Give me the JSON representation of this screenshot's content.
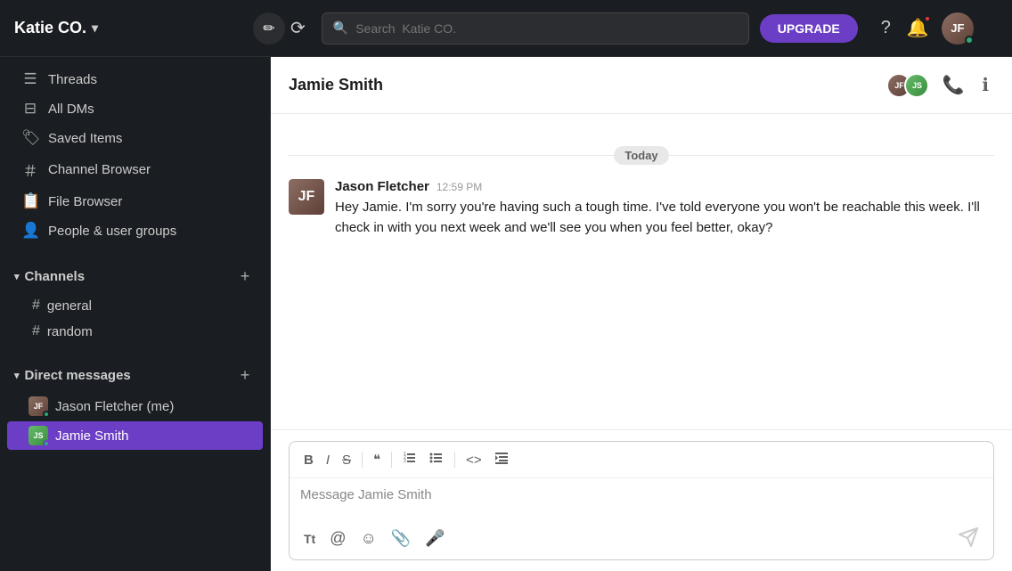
{
  "topbar": {
    "workspace_name": "Katie CO.",
    "chevron": "▾",
    "search_placeholder": "Search  Katie CO.",
    "upgrade_label": "UPGRADE",
    "history_icon": "↺",
    "help_icon": "?",
    "notification_icon": "🔔"
  },
  "sidebar": {
    "nav_items": [
      {
        "id": "threads",
        "label": "Threads",
        "icon": "≡"
      },
      {
        "id": "all-dms",
        "label": "All DMs",
        "icon": "⊡"
      },
      {
        "id": "saved",
        "label": "Saved Items",
        "icon": "🔖"
      },
      {
        "id": "channel-browser",
        "label": "Channel Browser",
        "icon": "#"
      },
      {
        "id": "file-browser",
        "label": "File Browser",
        "icon": "📄"
      },
      {
        "id": "people",
        "label": "People & user groups",
        "icon": "👥"
      }
    ],
    "channels_label": "Channels",
    "channels": [
      {
        "id": "general",
        "name": "general"
      },
      {
        "id": "random",
        "name": "random"
      }
    ],
    "direct_messages_label": "Direct messages",
    "dms": [
      {
        "id": "jason-fletcher",
        "name": "Jason Fletcher (me)",
        "status": "green"
      },
      {
        "id": "jamie-smith",
        "name": "Jamie Smith",
        "status": "green",
        "active": true
      }
    ],
    "add_channel_label": "+",
    "add_dm_label": "+"
  },
  "chat": {
    "title": "Jamie Smith",
    "date_divider": "Today",
    "messages": [
      {
        "id": "msg1",
        "sender": "Jason Fletcher",
        "time": "12:59 PM",
        "avatar_initials": "JF",
        "text": "Hey Jamie. I'm sorry you're having such a tough time. I've told everyone you won't be reachable this week. I'll check in with you next week and we'll see you when you feel better, okay?"
      }
    ],
    "input_placeholder": "Message Jamie Smith"
  },
  "toolbar_buttons": [
    {
      "id": "bold",
      "label": "B"
    },
    {
      "id": "italic",
      "label": "I"
    },
    {
      "id": "strike",
      "label": "S"
    },
    {
      "id": "quote",
      "label": "❝"
    },
    {
      "id": "ol",
      "label": "≡"
    },
    {
      "id": "ul",
      "label": "≡"
    },
    {
      "id": "code",
      "label": "<>"
    },
    {
      "id": "indent",
      "label": "⇥"
    }
  ],
  "action_buttons": [
    {
      "id": "text-format",
      "icon": "Tt"
    },
    {
      "id": "mention",
      "icon": "@"
    },
    {
      "id": "emoji",
      "icon": "☺"
    },
    {
      "id": "attach",
      "icon": "📎"
    },
    {
      "id": "voice",
      "icon": "🎤"
    }
  ]
}
